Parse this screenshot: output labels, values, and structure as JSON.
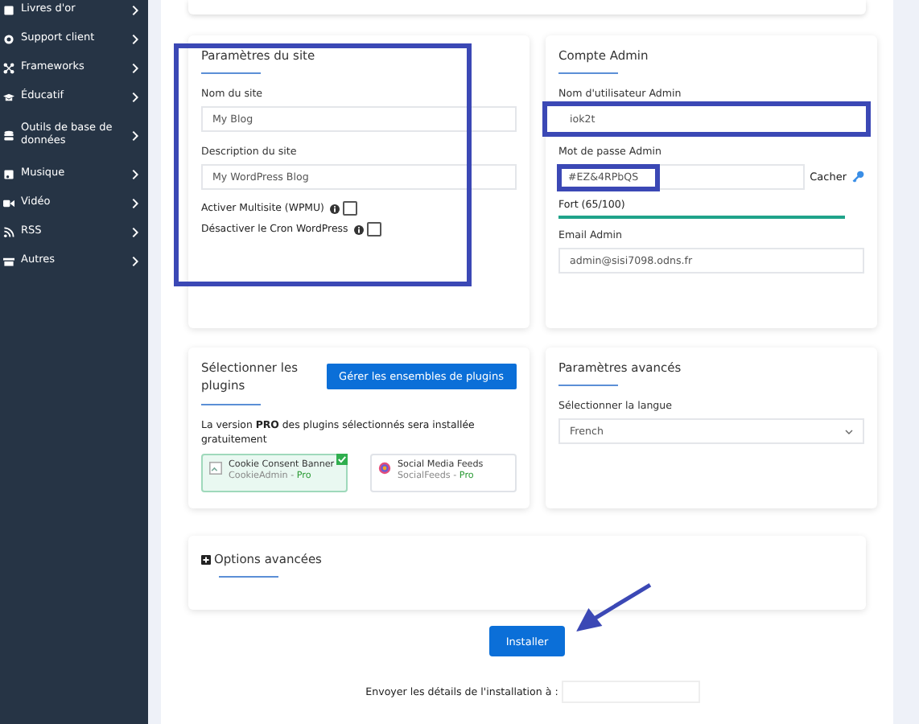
{
  "sidebar": {
    "items": [
      {
        "label": "Livres d'or"
      },
      {
        "label": "Support client"
      },
      {
        "label": "Frameworks"
      },
      {
        "label": "Éducatif"
      },
      {
        "label": "Outils de base de données"
      },
      {
        "label": "Musique"
      },
      {
        "label": "Vidéo"
      },
      {
        "label": "RSS"
      },
      {
        "label": "Autres"
      }
    ]
  },
  "site_settings": {
    "title": "Paramètres du site",
    "fields": [
      {
        "label": "Nom du site",
        "value": "My Blog"
      },
      {
        "label": "Description du site",
        "value": "My WordPress Blog"
      }
    ],
    "options": [
      {
        "label": "Activer Multisite (WPMU)",
        "checked": false
      },
      {
        "label": "Désactiver le Cron WordPress",
        "checked": false
      }
    ]
  },
  "admin_account": {
    "title": "Compte Admin",
    "username_label": "Nom d'utilisateur Admin",
    "username": "iok2t",
    "password_label": "Mot de passe Admin",
    "password": "#EZ&4RPbQS",
    "toggle": "Cacher",
    "strength": "Fort (65/100)",
    "email_label": "Email Admin",
    "email": "admin@sisi7098.odns.fr"
  },
  "plugins": {
    "title": "Sélectionner les plugins",
    "manage_button": "Gérer les ensembles de plugins",
    "note": "La version **PRO** des plugins sélectionnés sera installée gratuitement",
    "items": [
      {
        "name": "Cookie Consent Banner",
        "vendor": "CookieAdmin -",
        "tier": "Pro",
        "selected": true
      },
      {
        "name": "Social Media Feeds",
        "vendor": "SocialFeeds -",
        "tier": "Pro",
        "selected": false
      }
    ]
  },
  "advanced": {
    "title": "Paramètres avancés",
    "language_label": "Sélectionner la langue",
    "language": "French"
  },
  "advanced_options": {
    "title": "Options avancées",
    "expanded": false
  },
  "install_button": "Installer",
  "send_details": {
    "label": "Envoyer les détails de l'installation à :"
  }
}
